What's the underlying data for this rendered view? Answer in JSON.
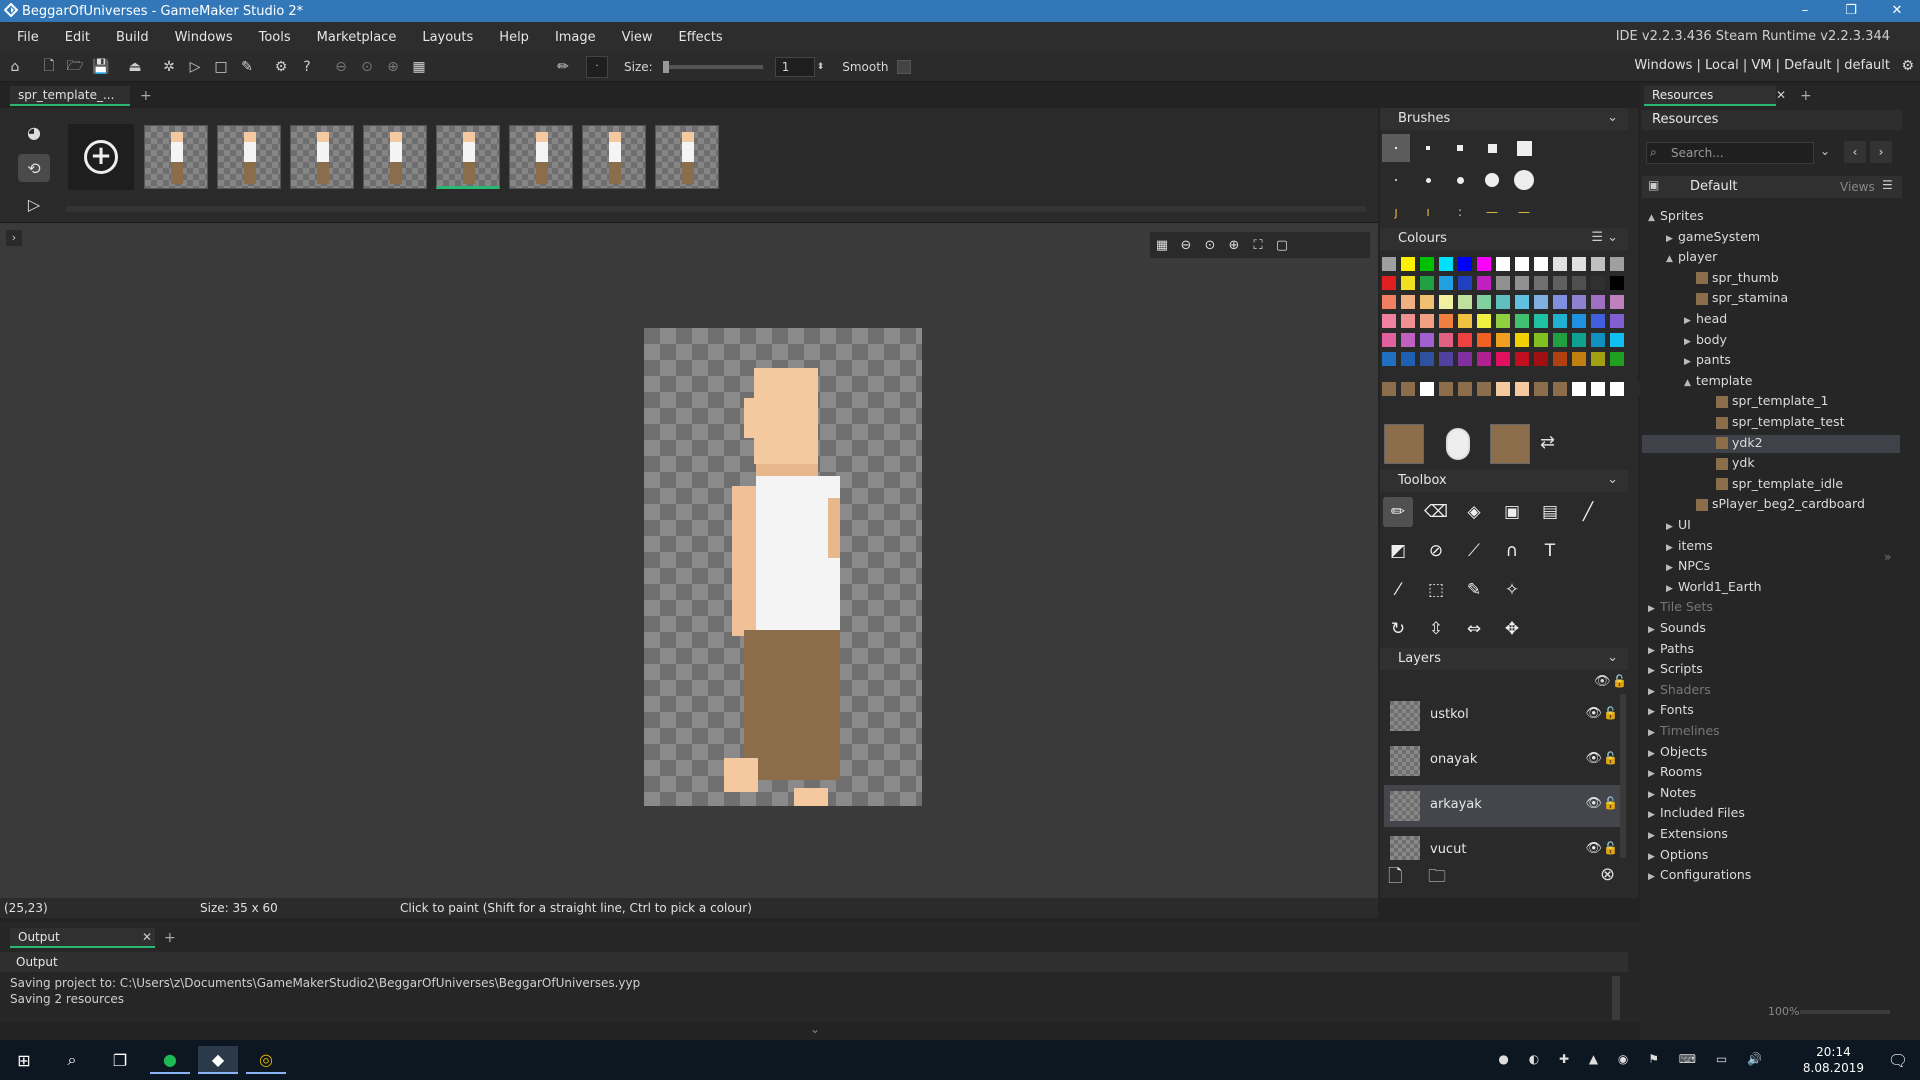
{
  "window": {
    "title": "BeggarOfUniverses - GameMaker Studio 2*",
    "controls": [
      "–",
      "❐",
      "✕"
    ]
  },
  "menubar": {
    "items": [
      "File",
      "Edit",
      "Build",
      "Windows",
      "Tools",
      "Marketplace",
      "Layouts",
      "Help",
      "Image",
      "View",
      "Effects"
    ],
    "version": "IDE v2.2.3.436 Steam  Runtime v2.2.3.344"
  },
  "toolbar": {
    "size_label": "Size:",
    "size_value": "1",
    "smooth_label": "Smooth",
    "target": "Windows | Local | VM | Default | default"
  },
  "doc_tab": {
    "label": "spr_template_..."
  },
  "sprite_editor": {
    "frame_count": 8,
    "selected_frame": 5,
    "status": {
      "coords": "(25,23)",
      "size": "Size: 35 x 60",
      "hint": "Click to paint (Shift for a straight line, Ctrl to pick a colour)"
    }
  },
  "panels": {
    "brushes": "Brushes",
    "colours": "Colours",
    "toolbox": "Toolbox",
    "layers": "Layers",
    "layer_items": [
      {
        "name": "ustkol",
        "selected": false
      },
      {
        "name": "onayak",
        "selected": false
      },
      {
        "name": "arkayak",
        "selected": true
      },
      {
        "name": "vucut",
        "selected": false
      }
    ],
    "primary_colour": "#8b6d4b",
    "secondary_colour": "#8b6d4b"
  },
  "palette": [
    "#a0a0a0",
    "#fff000",
    "#00c000",
    "#00e0ff",
    "#0000ff",
    "#ff00ff",
    "#ffffff",
    "#ffffff",
    "#ffffff",
    "#e0e0e0",
    "#e0e0e0",
    "#c0c0c0",
    "#a0a0a0",
    "#e02020",
    "#f0e020",
    "#20a040",
    "#20a0e0",
    "#2040c0",
    "#c020c0",
    "#909090",
    "#909090",
    "#707070",
    "#606060",
    "#505050",
    "#303030",
    "#000000",
    "#f08060",
    "#f0b080",
    "#f0c070",
    "#f0f0a0",
    "#c0e0a0",
    "#80d0a0",
    "#60c0c0",
    "#60c0e0",
    "#80b0e0",
    "#8090e0",
    "#9080d0",
    "#a070c0",
    "#c080c0",
    "#f080a0",
    "#f09090",
    "#f0a080",
    "#f08040",
    "#f0c040",
    "#f0f040",
    "#90d040",
    "#40c070",
    "#20c0a0",
    "#20b0d0",
    "#2090e0",
    "#4060e0",
    "#8060d0",
    "#e060a0",
    "#c060c0",
    "#a060d0",
    "#e06080",
    "#f04040",
    "#f06020",
    "#f0a020",
    "#f0d000",
    "#80c020",
    "#20a040",
    "#10a090",
    "#1090c0",
    "#10c0f0",
    "#2070c0",
    "#2060b0",
    "#3050a0",
    "#5040a0",
    "#8030a0",
    "#b02090",
    "#e01060",
    "#c01020",
    "#a01010",
    "#b04010",
    "#c08010",
    "#a0a010",
    "#20a020"
  ],
  "custom_palette": [
    "#8b6d4b",
    "#8b6d4b",
    "#ffffff",
    "#8b6d4b",
    "#8b6d4b",
    "#8b6d4b",
    "#f5c9a0",
    "#f5c9a0",
    "#8b6d4b",
    "#8b6d4b",
    "#ffffff",
    "#ffffff",
    "#ffffff",
    "#2a2a2a"
  ],
  "output": {
    "tab": "Output",
    "header": "Output",
    "lines": [
      "Saving project to: C:\\Users\\z\\Documents\\GameMakerStudio2\\BeggarOfUniverses\\BeggarOfUniverses.yyp",
      "Saving 2 resources"
    ]
  },
  "resources": {
    "tab": "Resources",
    "header": "Resources",
    "search_placeholder": "Search...",
    "default_label": "Default",
    "views_label": "Views",
    "tree": [
      {
        "label": "Sprites",
        "depth": 0,
        "arrow": "▲",
        "dim": false
      },
      {
        "label": "gameSystem",
        "depth": 1,
        "arrow": "▶",
        "dim": false
      },
      {
        "label": "player",
        "depth": 1,
        "arrow": "▲",
        "dim": false
      },
      {
        "label": "spr_thumb",
        "depth": 2,
        "arrow": "",
        "dim": false
      },
      {
        "label": "spr_stamina",
        "depth": 2,
        "arrow": "",
        "dim": false
      },
      {
        "label": "head",
        "depth": 2,
        "arrow": "▶",
        "dim": false
      },
      {
        "label": "body",
        "depth": 2,
        "arrow": "▶",
        "dim": false
      },
      {
        "label": "pants",
        "depth": 2,
        "arrow": "▶",
        "dim": false
      },
      {
        "label": "template",
        "depth": 2,
        "arrow": "▲",
        "dim": false
      },
      {
        "label": "spr_template_1",
        "depth": 3,
        "arrow": "",
        "dim": false
      },
      {
        "label": "spr_template_test",
        "depth": 3,
        "arrow": "",
        "dim": false
      },
      {
        "label": "ydk2",
        "depth": 3,
        "arrow": "",
        "dim": false,
        "selected": true
      },
      {
        "label": "ydk",
        "depth": 3,
        "arrow": "",
        "dim": false
      },
      {
        "label": "spr_template_idle",
        "depth": 3,
        "arrow": "",
        "dim": false
      },
      {
        "label": "sPlayer_beg2_cardboard",
        "depth": 2,
        "arrow": "",
        "dim": false
      },
      {
        "label": "UI",
        "depth": 1,
        "arrow": "▶",
        "dim": false
      },
      {
        "label": "items",
        "depth": 1,
        "arrow": "▶",
        "dim": false
      },
      {
        "label": "NPCs",
        "depth": 1,
        "arrow": "▶",
        "dim": false
      },
      {
        "label": "World1_Earth",
        "depth": 1,
        "arrow": "▶",
        "dim": false
      },
      {
        "label": "Tile Sets",
        "depth": 0,
        "arrow": "▶",
        "dim": true
      },
      {
        "label": "Sounds",
        "depth": 0,
        "arrow": "▶",
        "dim": false
      },
      {
        "label": "Paths",
        "depth": 0,
        "arrow": "▶",
        "dim": false
      },
      {
        "label": "Scripts",
        "depth": 0,
        "arrow": "▶",
        "dim": false
      },
      {
        "label": "Shaders",
        "depth": 0,
        "arrow": "▶",
        "dim": true
      },
      {
        "label": "Fonts",
        "depth": 0,
        "arrow": "▶",
        "dim": false
      },
      {
        "label": "Timelines",
        "depth": 0,
        "arrow": "▶",
        "dim": true
      },
      {
        "label": "Objects",
        "depth": 0,
        "arrow": "▶",
        "dim": false
      },
      {
        "label": "Rooms",
        "depth": 0,
        "arrow": "▶",
        "dim": false
      },
      {
        "label": "Notes",
        "depth": 0,
        "arrow": "▶",
        "dim": false
      },
      {
        "label": "Included Files",
        "depth": 0,
        "arrow": "▶",
        "dim": false
      },
      {
        "label": "Extensions",
        "depth": 0,
        "arrow": "▶",
        "dim": false
      },
      {
        "label": "Options",
        "depth": 0,
        "arrow": "▶",
        "dim": false
      },
      {
        "label": "Configurations",
        "depth": 0,
        "arrow": "▶",
        "dim": false
      }
    ],
    "zoom": "100%"
  },
  "taskbar": {
    "time": "20:14",
    "date": "8.08.2019"
  }
}
